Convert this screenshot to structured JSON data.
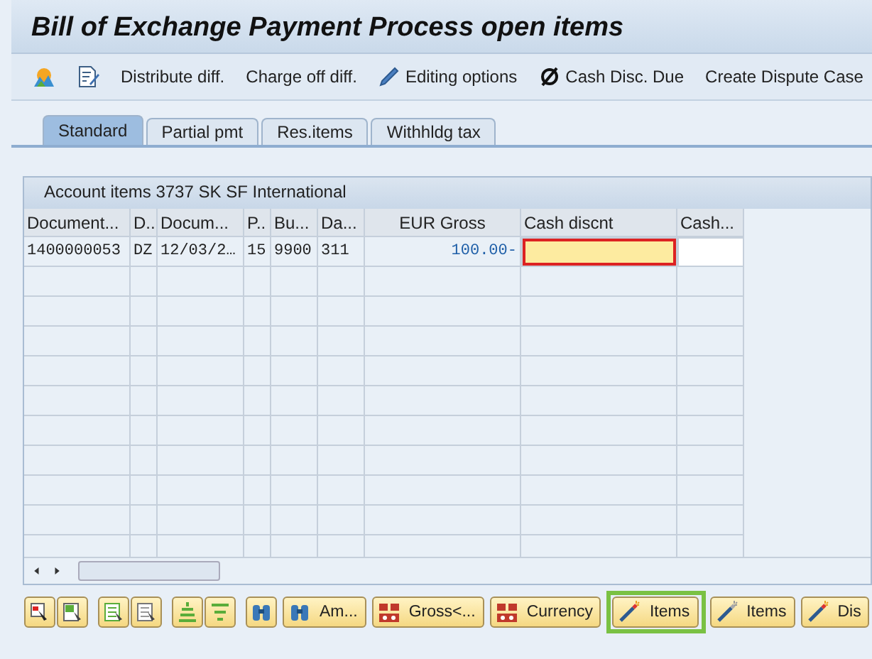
{
  "window": {
    "title": "Bill of Exchange Payment Process open items"
  },
  "toolbar": [
    {
      "kind": "picture"
    },
    {
      "kind": "edit"
    },
    {
      "kind": "text",
      "label": "Distribute diff."
    },
    {
      "kind": "text",
      "label": "Charge off diff."
    },
    {
      "kind": "pencil",
      "label": "Editing options"
    },
    {
      "kind": "nosign",
      "label": "Cash Disc. Due"
    },
    {
      "kind": "text",
      "label": "Create Dispute Case"
    }
  ],
  "tabs": [
    {
      "label": "Standard",
      "selected": true
    },
    {
      "label": "Partial pmt",
      "selected": false
    },
    {
      "label": "Res.items",
      "selected": false
    },
    {
      "label": "Withhldg tax",
      "selected": false
    }
  ],
  "table": {
    "title": "Account items 3737 SK SF International",
    "columns": [
      {
        "label": "Document...",
        "kind": "text"
      },
      {
        "label": "D..",
        "kind": "text"
      },
      {
        "label": "Docum...",
        "kind": "text"
      },
      {
        "label": "P..",
        "kind": "text"
      },
      {
        "label": "Bu...",
        "kind": "text"
      },
      {
        "label": "Da...",
        "kind": "text"
      },
      {
        "label": "EUR Gross",
        "kind": "amount"
      },
      {
        "label": "Cash discnt",
        "kind": "input"
      },
      {
        "label": "Cash...",
        "kind": "input"
      }
    ],
    "rows": [
      {
        "cells": [
          "1400000053",
          "DZ",
          "12/03/2…",
          "15",
          "9900",
          "311",
          "100.00-"
        ],
        "inputs": [
          {
            "focused": true
          },
          {
            "focused": false
          }
        ]
      }
    ]
  },
  "buttons": [
    {
      "kind": "select-arrow"
    },
    {
      "kind": "select-doc"
    },
    {
      "kind": "doc-arrow"
    },
    {
      "kind": "doc-arrow2"
    },
    {
      "kind": "sort-up"
    },
    {
      "kind": "filter"
    },
    {
      "kind": "binoculars"
    },
    {
      "kind": "binoculars",
      "label": "Am..."
    },
    {
      "kind": "money",
      "label": "Gross<..."
    },
    {
      "kind": "money",
      "label": "Currency"
    },
    {
      "kind": "wand",
      "label": "Items",
      "highlighted": true
    },
    {
      "kind": "wand-grey",
      "label": "Items",
      "highlighted": false
    },
    {
      "kind": "wand",
      "label": "Dis",
      "highlighted": false
    }
  ]
}
